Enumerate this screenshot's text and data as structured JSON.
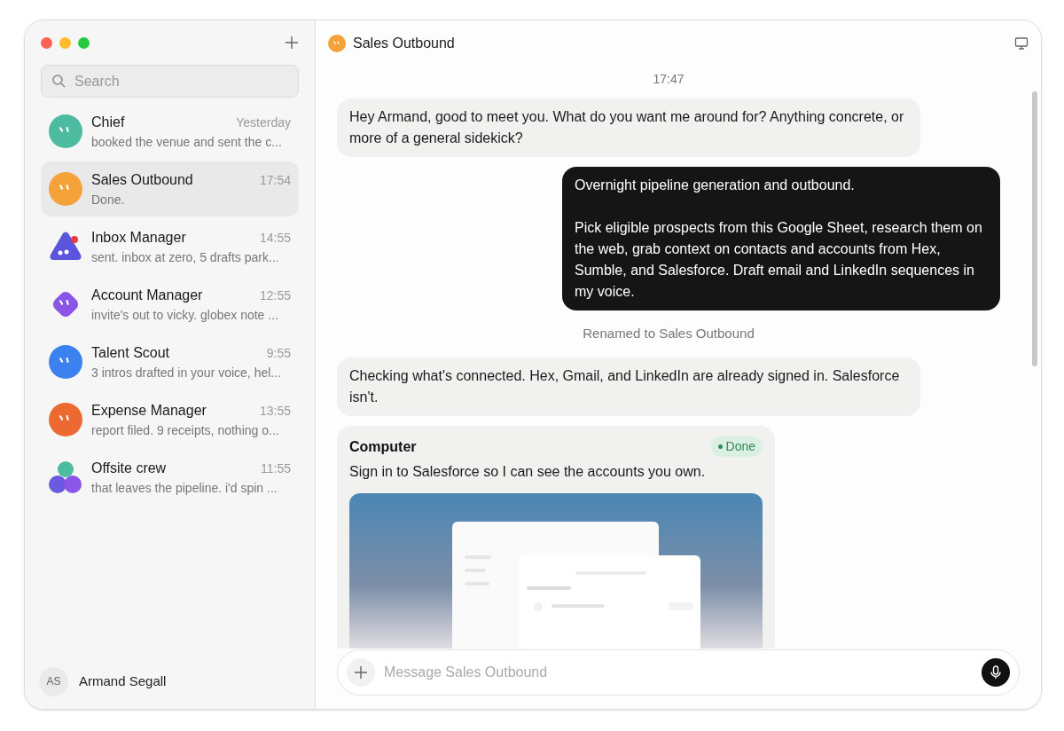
{
  "sidebar": {
    "search": {
      "placeholder": "Search"
    },
    "chats": [
      {
        "name": "Chief",
        "time": "Yesterday",
        "preview": "booked the venue and sent the c...",
        "kind": "circle",
        "color": "#4dbb9f",
        "selected": false
      },
      {
        "name": "Sales Outbound",
        "time": "17:54",
        "preview": "Done.",
        "kind": "circle",
        "color": "#f5a23a",
        "selected": true
      },
      {
        "name": "Inbox Manager",
        "time": "14:55",
        "preview": "sent. inbox at zero, 5 drafts park...",
        "kind": "blob",
        "color": "#5a55dc",
        "selected": false
      },
      {
        "name": "Account Manager",
        "time": "12:55",
        "preview": "invite's out to vicky. globex note ...",
        "kind": "diamond",
        "color": "#8b55e8",
        "selected": false
      },
      {
        "name": "Talent Scout",
        "time": "9:55",
        "preview": "3 intros drafted in your voice, hel...",
        "kind": "circle",
        "color": "#3b82f0",
        "selected": false
      },
      {
        "name": "Expense Manager",
        "time": "13:55",
        "preview": "report filed. 9 receipts, nothing o...",
        "kind": "circle",
        "color": "#ec6a32",
        "selected": false
      },
      {
        "name": "Offsite crew",
        "time": "11:55",
        "preview": "that leaves the pipeline. i'd spin ...",
        "kind": "group",
        "color": "#6a5ae0",
        "selected": false
      }
    ],
    "user": {
      "initials": "AS",
      "name": "Armand Segall"
    }
  },
  "chat": {
    "title": "Sales Outbound",
    "color": "#f5a23a",
    "messages": [
      {
        "kind": "time",
        "text": "17:47"
      },
      {
        "kind": "incoming",
        "paragraphs": [
          "Hey Armand, good to meet you. What do you want me around for? Anything concrete, or more of a general sidekick?"
        ]
      },
      {
        "kind": "outgoing",
        "paragraphs": [
          "Overnight pipeline generation and outbound.",
          "Pick eligible prospects from this Google Sheet, research them on the web, grab context on contacts and accounts from Hex, Sumble, and Salesforce. Draft email and LinkedIn sequences in my voice."
        ]
      },
      {
        "kind": "system",
        "text": "Renamed to Sales Outbound"
      },
      {
        "kind": "incoming",
        "paragraphs": [
          "Checking what's connected. Hex, Gmail, and LinkedIn are already signed in. Salesforce isn't."
        ]
      },
      {
        "kind": "tool",
        "title": "Computer",
        "status": "Done",
        "done": true,
        "text": "Sign in to Salesforce so I can see the accounts you own."
      }
    ],
    "composer": {
      "placeholder": "Message Sales Outbound"
    }
  }
}
